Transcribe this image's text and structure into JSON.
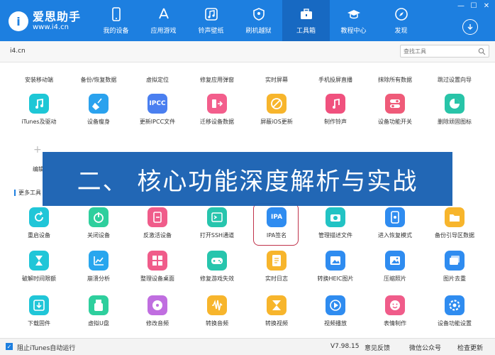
{
  "app": {
    "logo_mark": "i",
    "logo_name": "爱思助手",
    "logo_url": "www.i4.cn"
  },
  "nav": [
    {
      "label": "我的设备",
      "icon": "phone-icon"
    },
    {
      "label": "应用游戏",
      "icon": "app-store-icon"
    },
    {
      "label": "铃声壁纸",
      "icon": "music-icon"
    },
    {
      "label": "刷机越狱",
      "icon": "shield-icon"
    },
    {
      "label": "工具箱",
      "icon": "toolbox-icon",
      "active": true
    },
    {
      "label": "教程中心",
      "icon": "graduation-cap-icon"
    },
    {
      "label": "发现",
      "icon": "compass-icon"
    }
  ],
  "window": {
    "minimize": "—",
    "maximize": "☐",
    "close": "✕"
  },
  "tab": {
    "label": "i4.cn"
  },
  "search": {
    "placeholder": "查找工具"
  },
  "top_labels": [
    "安装移动端",
    "备份/恢复数据",
    "虚拟定位",
    "修复应用弹窗",
    "实时屏幕",
    "手机投屏直播",
    "抹除所有数据",
    "跳过设置向导"
  ],
  "row1": [
    {
      "label": "iTunes及驱动",
      "icon": "music-note-icon",
      "color": "#1ec7d6"
    },
    {
      "label": "设备瘦身",
      "icon": "broom-icon",
      "color": "#2aa2ee"
    },
    {
      "label": "更新IPCC文件",
      "icon": "ipcc-icon",
      "text": "IPCC",
      "color": "#4a7ff0"
    },
    {
      "label": "迁移设备数据",
      "icon": "transfer-icon",
      "color": "#f35e8c"
    },
    {
      "label": "屏蔽iOS更新",
      "icon": "block-update-icon",
      "color": "#f7b52c"
    },
    {
      "label": "制作铃声",
      "icon": "bell-music-icon",
      "color": "#f0517e"
    },
    {
      "label": "设备功能开关",
      "icon": "toggle-icon",
      "color": "#ef5b79"
    },
    {
      "label": "删除顽固图标",
      "icon": "pie-icon",
      "color": "#28c4a8"
    }
  ],
  "edit": {
    "plus": "+",
    "label": "编辑"
  },
  "section": {
    "title": "更多工具"
  },
  "banner": {
    "text": "二、 核心功能深度解析与实战"
  },
  "row2": [
    {
      "label": "重启设备",
      "icon": "restart-icon",
      "color": "#20c6d8"
    },
    {
      "label": "关闭设备",
      "icon": "power-icon",
      "color": "#2ecf9d"
    },
    {
      "label": "反激活设备",
      "icon": "deactivate-icon",
      "color": "#f05c8a"
    },
    {
      "label": "打开SSH通道",
      "icon": "ssh-icon",
      "color": "#27c5ad"
    },
    {
      "label": "IPA签名",
      "icon": "ipa-icon",
      "text": "IPA",
      "color": "#2f8cf0"
    },
    {
      "label": "管理描述文件",
      "icon": "camera-icon",
      "color": "#22c3c4"
    },
    {
      "label": "进入恢复模式",
      "icon": "recovery-icon",
      "color": "#2f8cf0"
    },
    {
      "label": "备份引导区数据",
      "icon": "folder-icon",
      "color": "#f7b52c"
    }
  ],
  "row3": [
    {
      "label": "破解时间限额",
      "icon": "hourglass-icon",
      "color": "#20c6d8"
    },
    {
      "label": "崩溃分析",
      "icon": "chart-icon",
      "color": "#28a6ee"
    },
    {
      "label": "整理设备桌面",
      "icon": "grid-icon",
      "color": "#f05c8a"
    },
    {
      "label": "修复游戏失效",
      "icon": "gamepad-icon",
      "color": "#27c5ad"
    },
    {
      "label": "实时日志",
      "icon": "log-icon",
      "color": "#f7b52c"
    },
    {
      "label": "转换HEIC图片",
      "icon": "image-convert-icon",
      "color": "#2f8cf0"
    },
    {
      "label": "压缩照片",
      "icon": "photo-icon",
      "color": "#2f8cf0"
    },
    {
      "label": "图片去重",
      "icon": "image-dedupe-icon",
      "color": "#2f8cf0"
    }
  ],
  "row4": [
    {
      "label": "下载固件",
      "icon": "download-box-icon",
      "color": "#20c6d8"
    },
    {
      "label": "虚拟U盘",
      "icon": "usb-icon",
      "color": "#2ecf9d"
    },
    {
      "label": "修改音频",
      "icon": "audio-icon",
      "color": "#c06ee0"
    },
    {
      "label": "转换音频",
      "icon": "waveform-icon",
      "color": "#f7b52c"
    },
    {
      "label": "转换视频",
      "icon": "video-icon",
      "color": "#f7b52c"
    },
    {
      "label": "视频播放",
      "icon": "play-icon",
      "color": "#2f8cf0"
    },
    {
      "label": "表情制作",
      "icon": "emoji-icon",
      "color": "#f05c8a"
    },
    {
      "label": "设备功能设置",
      "icon": "settings-icon",
      "color": "#2f8cf0"
    }
  ],
  "footer": {
    "check_mark": "✓",
    "itunes_label": "阻止iTunes自动运行",
    "version": "V7.98.15",
    "feedback": "意见反馈",
    "wechat": "微信公众号",
    "update": "检查更新"
  }
}
